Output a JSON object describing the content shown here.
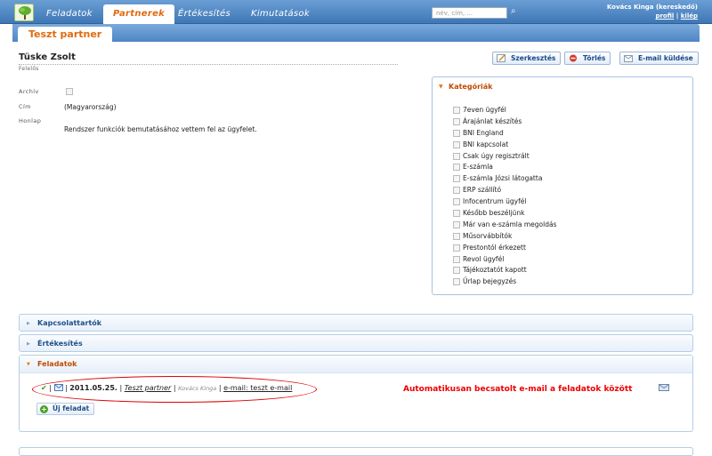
{
  "nav": {
    "tabs": [
      {
        "label": "Feladatok"
      },
      {
        "label": "Partnerek",
        "active": true
      },
      {
        "label": "Értékesítés"
      },
      {
        "label": "Kimutatások"
      }
    ],
    "search_placeholder": "név, cím, ...",
    "user_name": "Kovács Kinga (kereskedő)",
    "profile_link": "profil",
    "logout_link": "kilép",
    "separator": "|"
  },
  "partner_tab": "Teszt partner",
  "header": {
    "name": "Tüske Zsolt",
    "role": "Felelős"
  },
  "actions": {
    "edit": "Szerkesztés",
    "delete": "Törlés",
    "email": "E-mail küldése"
  },
  "details": {
    "archive_label": "Archív",
    "address_label": "Cím",
    "address_value": "(Magyarország)",
    "homepage_label": "Honlap",
    "homepage_value": "Rendszer funkciók bemutatásához vettem fel az ügyfelet."
  },
  "categories": {
    "title": "Kategóriák",
    "items": [
      "7even ügyfél",
      "Árajánlat készítés",
      "BNI England",
      "BNI kapcsolat",
      "Csak úgy regisztrált",
      "E-számla",
      "E-számla Józsi látogatta",
      "ERP szállító",
      "Infocentrum ügyfél",
      "Később beszéljünk",
      "Már van e-számla megoldás",
      "Műsorvábbítók",
      "Prestontól érkezett",
      "Revol ügyfél",
      "Tájékoztatót kapott",
      "Űrlap bejegyzés"
    ]
  },
  "sections": {
    "contacts": "Kapcsolattartók",
    "sales": "Értékesítés",
    "tasks": "Feladatok"
  },
  "task": {
    "sep": "|",
    "date": "2011.05.25.",
    "partner": "Teszt partner",
    "owner": "Kovács Kinga",
    "email": "e-mail: teszt e-mail"
  },
  "annotation": "Automatikusan becsatolt e-mail a feladatok között",
  "new_task": "Új feladat",
  "colors": {
    "accent": "#e06a10",
    "annotation": "#e00000",
    "nav": "#4a82c2"
  }
}
